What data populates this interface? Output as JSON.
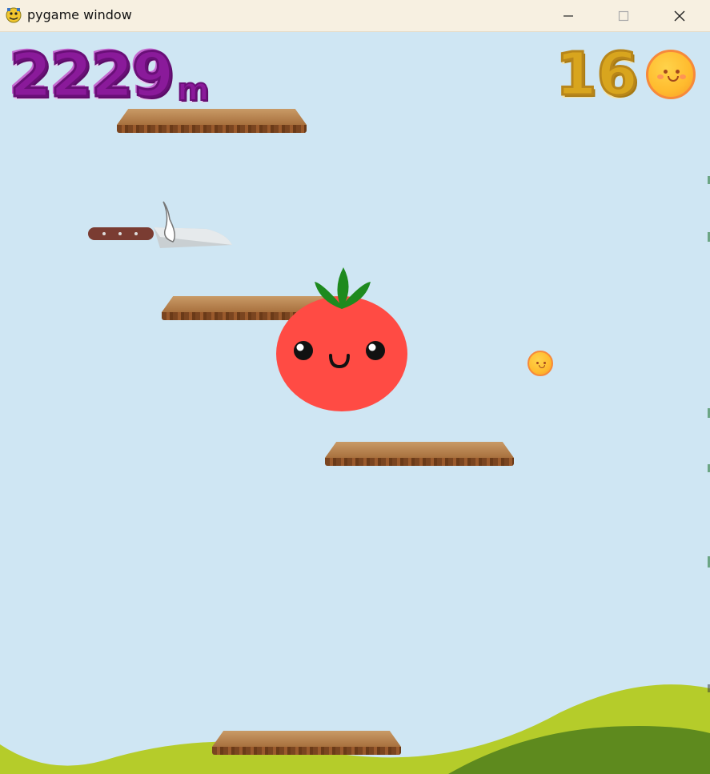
{
  "window": {
    "title": "pygame window",
    "app_icon": "pygame-snake-icon",
    "controls": [
      "minimize-icon",
      "maximize-icon",
      "close-icon"
    ]
  },
  "hud": {
    "distance_value": "2229",
    "distance_unit": "m",
    "coin_count": "16",
    "coin_icon": "smiley-coin-icon"
  },
  "scene": {
    "player": "tomato-character",
    "hazard": "kitchen-knife",
    "collectible": "smiley-coin",
    "platforms": [
      "cutting-board-platform",
      "cutting-board-platform",
      "cutting-board-platform",
      "cutting-board-platform"
    ],
    "background": "sky-with-green-hills",
    "colors": {
      "sky": "#cfe6f3",
      "distance_text": "#8a1a9a",
      "coin_text": "#d8a51e",
      "tomato": "#ff4b44",
      "leaf": "#1e8a1e",
      "hill_light": "#b5cc2a",
      "hill_dark": "#5e8a1e"
    }
  }
}
